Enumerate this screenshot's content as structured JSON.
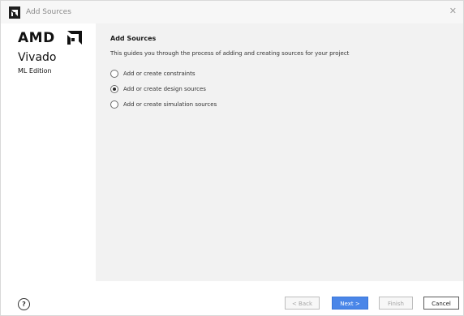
{
  "window": {
    "title": "Add Sources",
    "close_glyph": "✕"
  },
  "brand": {
    "company": "AMD",
    "product": "Vivado",
    "edition": "ML Edition"
  },
  "page": {
    "heading": "Add Sources",
    "description": "This guides you through the process of adding and creating sources for your project"
  },
  "options": [
    {
      "label": "Add or create constraints",
      "selected": false
    },
    {
      "label": "Add or create design sources",
      "selected": true
    },
    {
      "label": "Add or create simulation sources",
      "selected": false
    }
  ],
  "footer": {
    "help_label": "?",
    "back_label": "< Back",
    "next_label": "Next >",
    "finish_label": "Finish",
    "cancel_label": "Cancel"
  },
  "colors": {
    "accent": "#4a86e8",
    "panel": "#f2f2f2"
  }
}
